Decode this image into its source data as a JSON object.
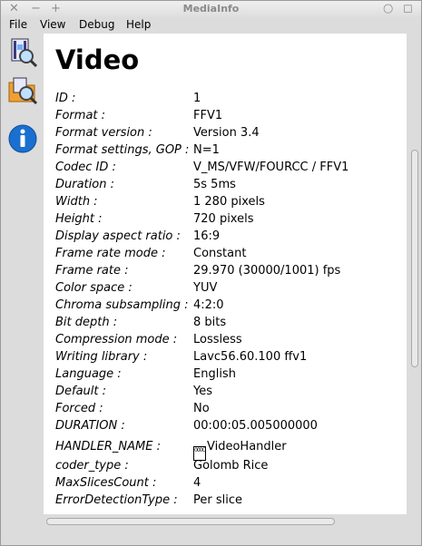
{
  "window": {
    "title": "MediaInfo",
    "controls": [
      "✕",
      "−",
      "+"
    ],
    "right_controls": [
      "○",
      "◻"
    ]
  },
  "menu": [
    "File",
    "View",
    "Debug",
    "Help"
  ],
  "toolbar": {
    "buttons": [
      "open-file-icon",
      "open-folder-icon",
      "about-info-icon"
    ]
  },
  "content": {
    "heading": "Video",
    "rows": [
      {
        "label": "ID :",
        "value": "1"
      },
      {
        "label": "Format :",
        "value": "FFV1"
      },
      {
        "label": "Format version :",
        "value": "Version 3.4"
      },
      {
        "label": "Format settings, GOP :",
        "value": "N=1"
      },
      {
        "label": "Codec ID :",
        "value": "V_MS/VFW/FOURCC / FFV1"
      },
      {
        "label": "Duration :",
        "value": "5s 5ms"
      },
      {
        "label": "Width :",
        "value": "1 280 pixels"
      },
      {
        "label": "Height :",
        "value": "720 pixels"
      },
      {
        "label": "Display aspect ratio :",
        "value": "16:9"
      },
      {
        "label": "Frame rate mode :",
        "value": "Constant"
      },
      {
        "label": "Frame rate :",
        "value": "29.970 (30000/1001) fps"
      },
      {
        "label": "Color space :",
        "value": "YUV"
      },
      {
        "label": "Chroma subsampling :",
        "value": "4:2:0"
      },
      {
        "label": "Bit depth :",
        "value": "8 bits"
      },
      {
        "label": "Compression mode :",
        "value": "Lossless"
      },
      {
        "label": "Writing library :",
        "value": "Lavc56.60.100 ffv1"
      },
      {
        "label": "Language :",
        "value": "English"
      },
      {
        "label": "Default :",
        "value": "Yes"
      },
      {
        "label": "Forced :",
        "value": "No"
      },
      {
        "label": "DURATION :",
        "value": "00:00:05.005000000"
      },
      {
        "label": "HANDLER_NAME :",
        "value": "VideoHandler",
        "glyph": "000C"
      },
      {
        "label": "coder_type :",
        "value": "Golomb Rice"
      },
      {
        "label": "MaxSlicesCount :",
        "value": "4"
      },
      {
        "label": "ErrorDetectionType :",
        "value": "Per slice"
      }
    ]
  },
  "colors": {
    "window_bg": "#dcdcdc",
    "content_bg": "#ffffff",
    "info_blue": "#1a6fd0"
  }
}
